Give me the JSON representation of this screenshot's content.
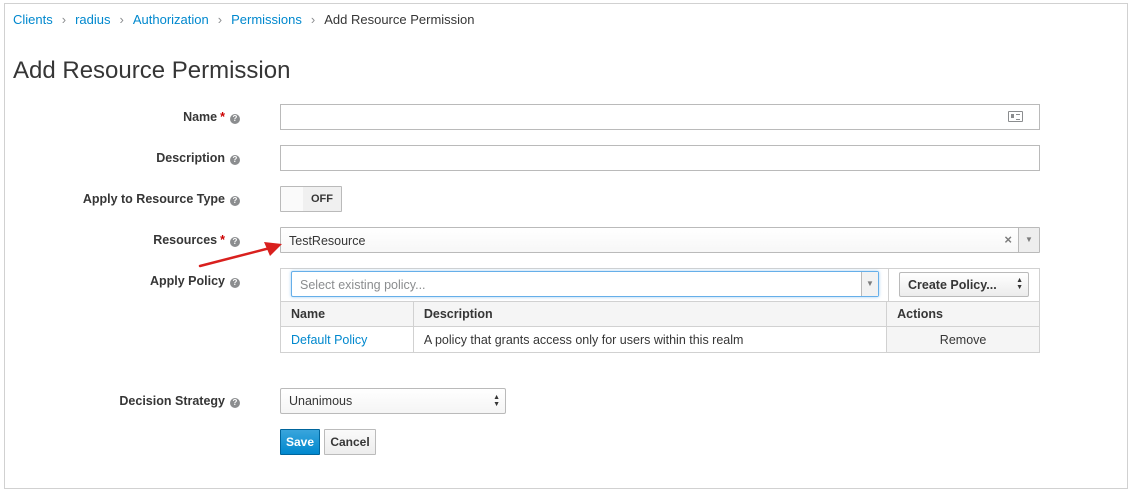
{
  "breadcrumb": {
    "items": [
      "Clients",
      "radius",
      "Authorization",
      "Permissions"
    ],
    "current": "Add Resource Permission"
  },
  "page": {
    "title": "Add Resource Permission"
  },
  "form": {
    "name": {
      "label": "Name",
      "required": true,
      "value": ""
    },
    "description": {
      "label": "Description",
      "value": ""
    },
    "apply_to_resource_type": {
      "label": "Apply to Resource Type",
      "state": "OFF"
    },
    "resources": {
      "label": "Resources",
      "required": true,
      "value": "TestResource"
    },
    "apply_policy": {
      "label": "Apply Policy",
      "search_placeholder": "Select existing policy...",
      "create_button": "Create Policy...",
      "table": {
        "headers": [
          "Name",
          "Description",
          "Actions"
        ],
        "rows": [
          {
            "name": "Default Policy",
            "description": "A policy that grants access only for users within this realm",
            "action": "Remove"
          }
        ]
      }
    },
    "decision_strategy": {
      "label": "Decision Strategy",
      "value": "Unanimous"
    }
  },
  "buttons": {
    "save": "Save",
    "cancel": "Cancel"
  },
  "colors": {
    "link": "#0088ce",
    "primary": "#0088ce",
    "required": "#cc0000",
    "annotation_arrow": "#d9201e"
  }
}
